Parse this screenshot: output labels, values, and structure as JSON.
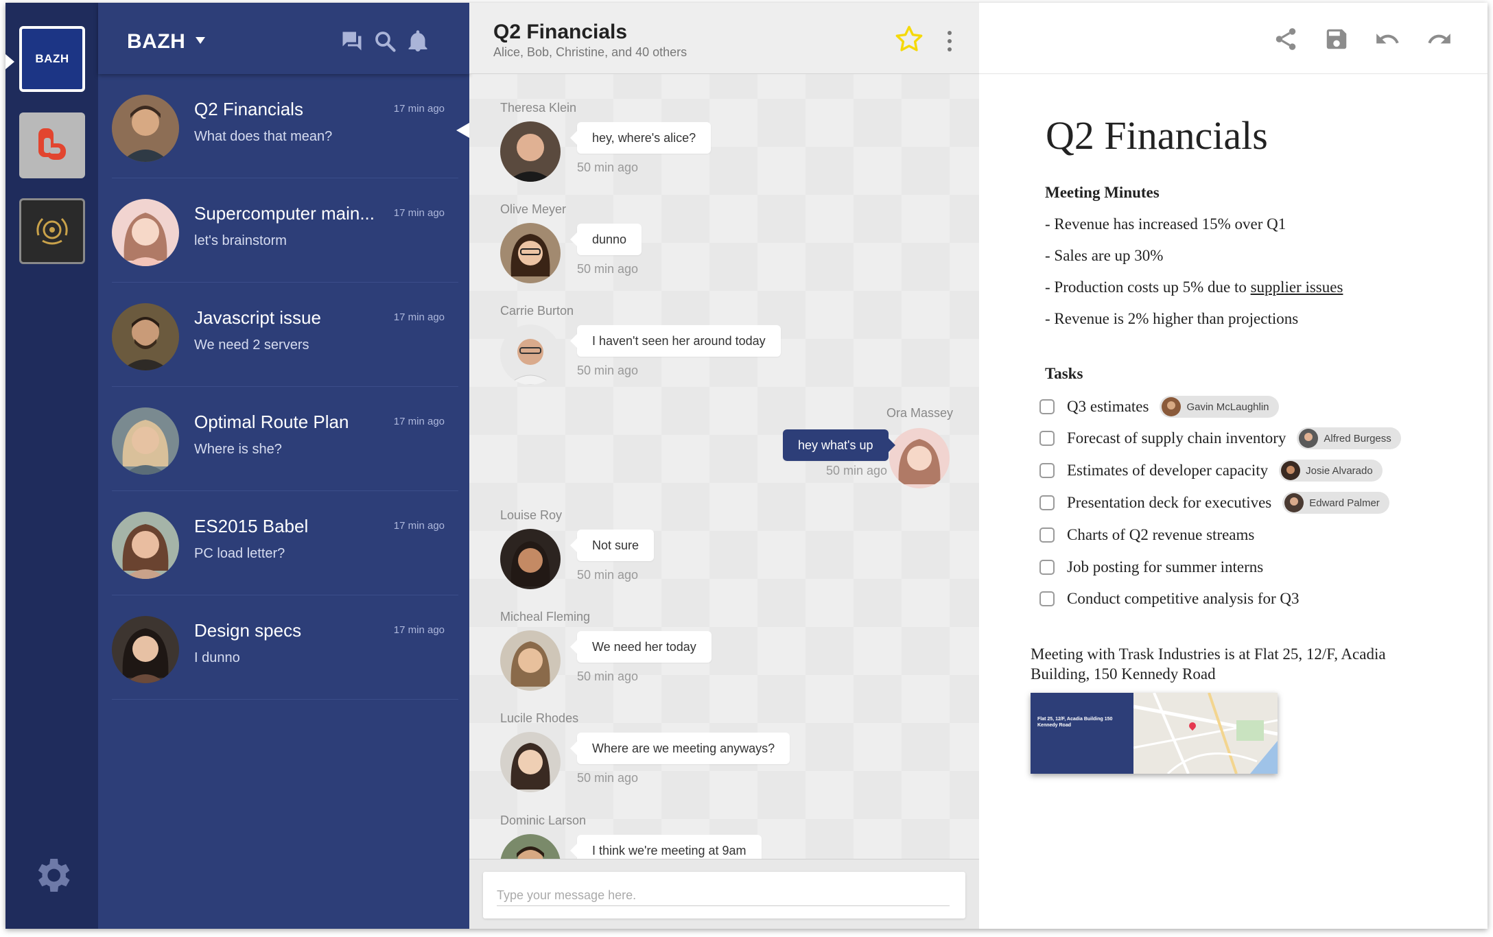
{
  "rail": {
    "workspaces": [
      {
        "label": "BAZH",
        "icon": "bazh-logo"
      },
      {
        "label": "",
        "icon": "hand-logo"
      },
      {
        "label": "",
        "icon": "wreath-logo"
      }
    ],
    "settings_icon": "gear-icon"
  },
  "conversations": {
    "brand": "BAZH",
    "header_icons": [
      "chat-icon",
      "search-icon",
      "bell-icon"
    ],
    "items": [
      {
        "name": "Q2 Financials",
        "time": "17 min ago",
        "last": "What does that mean?",
        "active": true
      },
      {
        "name": "Supercomputer main...",
        "time": "17 min ago",
        "last": "let's brainstorm"
      },
      {
        "name": "Javascript issue",
        "time": "17 min ago",
        "last": "We need 2 servers"
      },
      {
        "name": "Optimal Route Plan",
        "time": "17 min ago",
        "last": "Where is she?"
      },
      {
        "name": "ES2015 Babel",
        "time": "17 min ago",
        "last": "PC load letter?"
      },
      {
        "name": "Design specs",
        "time": "17 min ago",
        "last": "I dunno"
      }
    ]
  },
  "chat": {
    "title": "Q2 Financials",
    "subtitle": "Alice, Bob, Christine, and 40 others",
    "messages": [
      {
        "sender": "Theresa Klein",
        "text": "hey, where's alice?",
        "time": "50 min ago"
      },
      {
        "sender": "Olive Meyer",
        "text": "dunno",
        "time": "50 min ago"
      },
      {
        "sender": "Carrie Burton",
        "text": "I haven't seen her around today",
        "time": "50 min ago"
      },
      {
        "sender": "Ora Massey",
        "text": "hey what's up",
        "time": "50 min ago",
        "mine": true
      },
      {
        "sender": "Louise Roy",
        "text": "Not sure",
        "time": "50 min ago"
      },
      {
        "sender": "Micheal Fleming",
        "text": "We need her today",
        "time": "50 min ago"
      },
      {
        "sender": "Lucile Rhodes",
        "text": "Where are we meeting anyways?",
        "time": "50 min ago"
      },
      {
        "sender": "Dominic Larson",
        "text": "I think we're meeting at 9am",
        "time": ""
      }
    ],
    "input_placeholder": "Type your message here."
  },
  "doc": {
    "toolbar_icons": [
      "share-icon",
      "save-icon",
      "undo-icon",
      "redo-icon"
    ],
    "title": "Q2 Financials",
    "minutes_heading": "Meeting Minutes",
    "minutes": [
      "- Revenue has increased 15% over Q1",
      "- Sales are up 30%",
      "- Production costs up 5% due to ",
      "- Revenue is 2% higher than projections"
    ],
    "minutes_link": "supplier issues",
    "tasks_heading": "Tasks",
    "tasks": [
      {
        "text": "Q3 estimates",
        "assignee": "Gavin McLaughlin",
        "done": false
      },
      {
        "text": "Forecast of supply chain inventory",
        "assignee": "Alfred Burgess",
        "done": false
      },
      {
        "text": "Estimates of developer capacity",
        "assignee": "Josie Alvarado",
        "done": false
      },
      {
        "text": "Presentation deck for executives",
        "assignee": "Edward Palmer",
        "done": false
      },
      {
        "text": "Charts of Q2 revenue streams",
        "assignee": "",
        "done": false
      },
      {
        "text": "Job posting for summer interns",
        "assignee": "",
        "done": false
      },
      {
        "text": "Conduct competitive analysis for Q3",
        "assignee": "",
        "done": false
      }
    ],
    "meeting_note": "Meeting with Trask Industries is at Flat 25, 12/F, Acadia Building, 150 Kennedy Road",
    "map_label": "Flat 25, 12/F, Acadia Building 150 Kennedy Road"
  },
  "colors": {
    "rail": "#1f2c5c",
    "sidebar": "#2d3e78",
    "accent": "#1c3585",
    "star": "#f5d90a"
  }
}
